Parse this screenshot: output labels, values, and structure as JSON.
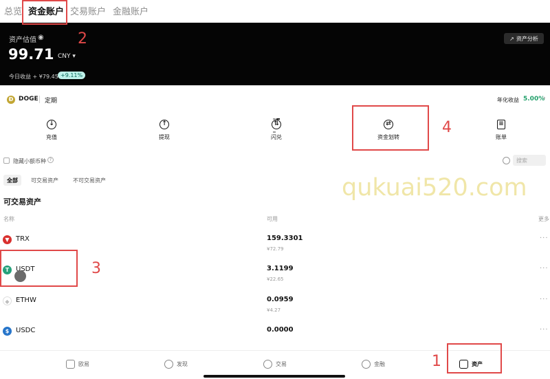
{
  "tabs": {
    "overview": "总览",
    "funding": "资金账户",
    "trading": "交易账户",
    "finance": "金融账户"
  },
  "hero": {
    "estimate_label": "资产估值",
    "value": "99.71",
    "currency": "CNY",
    "pnl_label": "今日收益 + ¥79.45",
    "pnl_pct": "+9.11%",
    "analysis_button": "资产分析"
  },
  "doge_bar": {
    "coin": "DOGE",
    "term": "定期",
    "apy_label": "年化收益",
    "apy": "5.00%"
  },
  "actions": {
    "deposit": "充值",
    "withdraw": "提现",
    "convert": "闪兑",
    "transfer": "资金划转",
    "bill": "账单"
  },
  "filters": {
    "hide_small": "隐藏小额币种",
    "search_placeholder": "搜索",
    "seg_all": "全部",
    "seg_tradable": "可交易资产",
    "seg_nontradable": "不可交易资产"
  },
  "section_title": "可交易资产",
  "columns": {
    "name": "名称",
    "available": "可用",
    "more": "更多"
  },
  "assets": [
    {
      "name": "TRX",
      "amount": "159.3301",
      "fiat": "¥72.79",
      "color": "#d9302e"
    },
    {
      "name": "USDT",
      "amount": "3.1199",
      "fiat": "¥22.65",
      "color": "#26a17b"
    },
    {
      "name": "ETHW",
      "amount": "0.0959",
      "fiat": "¥4.27",
      "color": "#bdbdbd"
    },
    {
      "name": "USDC",
      "amount": "0.0000",
      "fiat": "",
      "color": "#2775ca"
    }
  ],
  "bottom_nav": {
    "ouyi": "欧易",
    "discover": "发现",
    "trade": "交易",
    "finance": "金融",
    "assets": "资产"
  },
  "annotations": {
    "n1": "1",
    "n2": "2",
    "n3": "3",
    "n4": "4"
  },
  "watermark": "qukuai520.com"
}
